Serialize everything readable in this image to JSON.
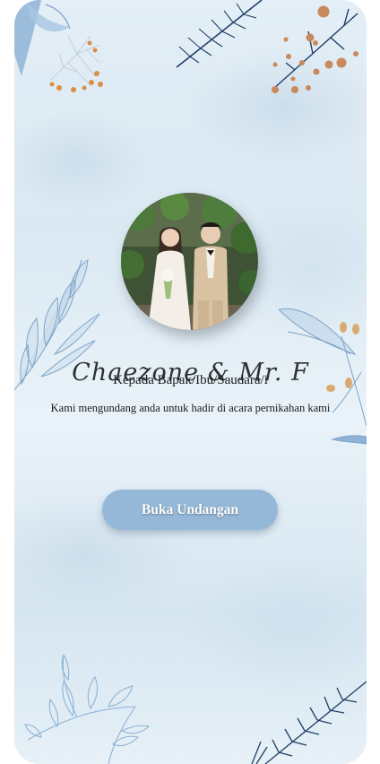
{
  "invitation": {
    "couple_names": "Chaezone & Mr. F",
    "greeting": "Kepada Bapak/Ibu/Saudara/i",
    "message": "Kami mengundang anda untuk hadir di acara pernikahan kami",
    "open_button_label": "Buka Undangan",
    "portrait_alt": "couple-portrait"
  },
  "theme": {
    "accent": "#95b8d8",
    "leaf_blue": "#8fb3d6",
    "leaf_navy": "#1f3f66",
    "berry_orange": "#d98f46",
    "background": "#e3eef6"
  }
}
